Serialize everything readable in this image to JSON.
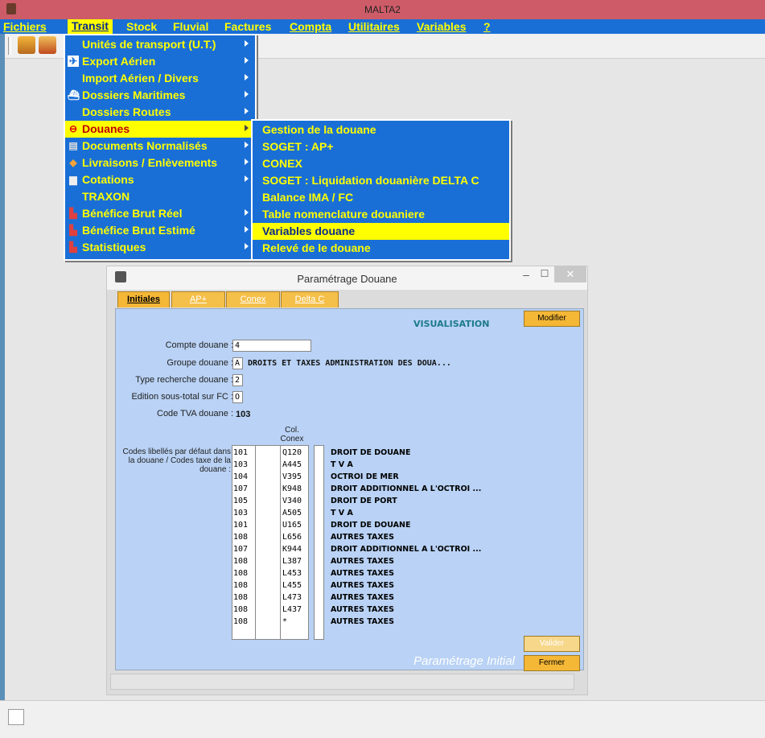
{
  "window": {
    "title": "MALTA2"
  },
  "menubar": [
    {
      "label": "Fichiers",
      "key": "F"
    },
    {
      "label": "Transit",
      "key": "T",
      "active": true
    },
    {
      "label": "Stock",
      "key": "S"
    },
    {
      "label": "Fluvial",
      "key": "l"
    },
    {
      "label": "Factures",
      "key": "a"
    },
    {
      "label": "Compta",
      "key": "C"
    },
    {
      "label": "Utilitaires",
      "key": "U"
    },
    {
      "label": "Variables",
      "key": "V"
    },
    {
      "label": "?",
      "key": "?"
    }
  ],
  "transit_menu": [
    {
      "label": "Unités de transport (U.T.)",
      "icon": "",
      "submenu": true
    },
    {
      "label": "Export Aérien",
      "icon": "plane-icon",
      "submenu": true
    },
    {
      "label": "Import Aérien / Divers",
      "icon": "",
      "submenu": true
    },
    {
      "label": "Dossiers Maritimes",
      "icon": "ship-icon",
      "submenu": true
    },
    {
      "label": "Dossiers Routes",
      "icon": "",
      "submenu": true
    },
    {
      "label": "Douanes",
      "icon": "no-entry-icon",
      "submenu": true,
      "selected": true
    },
    {
      "label": "Documents Normalisés",
      "icon": "document-icon",
      "submenu": true
    },
    {
      "label": "Livraisons / Enlèvements",
      "icon": "package-icon",
      "submenu": true
    },
    {
      "label": "Cotations",
      "icon": "folder-icon",
      "submenu": true
    },
    {
      "label": "TRAXON",
      "icon": "",
      "submenu": false
    },
    {
      "label": "Bénéfice Brut Réel",
      "icon": "bar-chart-icon",
      "submenu": true
    },
    {
      "label": "Bénéfice Brut Estimé",
      "icon": "bar-chart-icon",
      "submenu": true
    },
    {
      "label": "Statistiques",
      "icon": "bar-chart-icon",
      "submenu": true
    }
  ],
  "douanes_submenu": [
    {
      "label": "Gestion de la douane"
    },
    {
      "label": "SOGET : AP+"
    },
    {
      "label": "CONEX"
    },
    {
      "label": "SOGET : Liquidation douanière DELTA C"
    },
    {
      "label": "Balance IMA / FC"
    },
    {
      "label": "Table nomenclature douaniere"
    },
    {
      "label": "Variables douane",
      "selected": true
    },
    {
      "label": "Relevé de le douane"
    }
  ],
  "dialog": {
    "title": "Paramétrage Douane",
    "minimize": "–",
    "maximize": "☐",
    "close": "✕",
    "tabs": [
      "Initiales",
      "AP+",
      "Conex",
      "Delta C"
    ],
    "mode": "VISUALISATION",
    "fields": {
      "compte_label": "Compte douane :",
      "compte_value": "4",
      "groupe_label": "Groupe douane :",
      "groupe_value": "A",
      "groupe_text": "DROITS ET TAXES ADMINISTRATION DES DOUA...",
      "type_label": "Type recherche douane :",
      "type_value": "2",
      "edition_label": "Edition sous-total sur FC :",
      "edition_value": "O",
      "tva_label": "Code TVA douane :",
      "tva_value": "103"
    },
    "codes_label": "Codes libellés par défaut dans la douane / Codes taxe de la douane :",
    "col_header": "Col. Conex",
    "rows": [
      {
        "code": "101",
        "conex": "Q120",
        "libelle": "DROIT DE DOUANE"
      },
      {
        "code": "103",
        "conex": "A445",
        "libelle": "T V A"
      },
      {
        "code": "104",
        "conex": "V395",
        "libelle": "OCTROI DE MER"
      },
      {
        "code": "107",
        "conex": "K948",
        "libelle": "DROIT ADDITIONNEL A L'OCTROI ..."
      },
      {
        "code": "105",
        "conex": "V340",
        "libelle": "DROIT DE PORT"
      },
      {
        "code": "103",
        "conex": "A505",
        "libelle": "T V A"
      },
      {
        "code": "101",
        "conex": "U165",
        "libelle": "DROIT DE DOUANE"
      },
      {
        "code": "108",
        "conex": "L656",
        "libelle": "AUTRES TAXES"
      },
      {
        "code": "107",
        "conex": "K944",
        "libelle": "DROIT ADDITIONNEL A L'OCTROI ..."
      },
      {
        "code": "108",
        "conex": "L387",
        "libelle": "AUTRES TAXES"
      },
      {
        "code": "108",
        "conex": "L453",
        "libelle": "AUTRES TAXES"
      },
      {
        "code": "108",
        "conex": "L455",
        "libelle": "AUTRES TAXES"
      },
      {
        "code": "108",
        "conex": "L473",
        "libelle": "AUTRES TAXES"
      },
      {
        "code": "108",
        "conex": "L437",
        "libelle": "AUTRES TAXES"
      },
      {
        "code": "108",
        "conex": "*",
        "libelle": "AUTRES TAXES"
      }
    ],
    "buttons": {
      "modifier": "Modifier",
      "valider": "Valider",
      "fermer": "Fermer"
    },
    "watermark": "Paramétrage Initial"
  },
  "colors": {
    "menubar": "#1a6fd6",
    "menu_text": "#ffff00",
    "title_bar": "#cd5c68",
    "panel": "#b9d2f5",
    "button": "#f5b736"
  }
}
